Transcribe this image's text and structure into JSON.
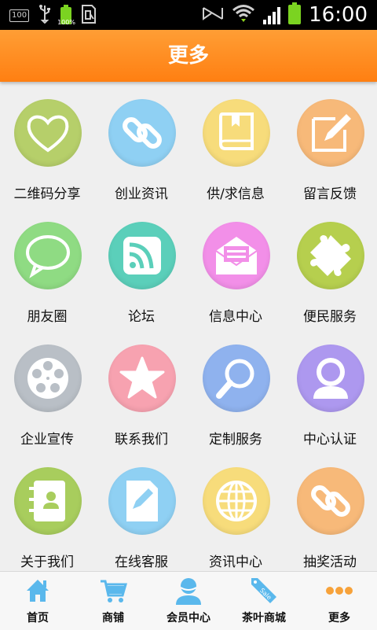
{
  "status_bar": {
    "box_text": "100",
    "battery_small": "100%",
    "time": "16:00"
  },
  "header": {
    "title": "更多"
  },
  "grid": {
    "items": [
      {
        "label": "二维码分享",
        "icon": "heart-icon",
        "color": "#b6cf6a"
      },
      {
        "label": "创业资讯",
        "icon": "link-icon",
        "color": "#8fd0f3"
      },
      {
        "label": "供/求信息",
        "icon": "book-icon",
        "color": "#f7dc7b"
      },
      {
        "label": "留言反馈",
        "icon": "edit-icon",
        "color": "#f7b979"
      },
      {
        "label": "朋友圈",
        "icon": "chat-bubble-icon",
        "color": "#8fdb83"
      },
      {
        "label": "论坛",
        "icon": "rss-icon",
        "color": "#5bcfba"
      },
      {
        "label": "信息中心",
        "icon": "envelope-icon",
        "color": "#f28fe8"
      },
      {
        "label": "便民服务",
        "icon": "puzzle-icon",
        "color": "#b6cf4e"
      },
      {
        "label": "企业宣传",
        "icon": "film-reel-icon",
        "color": "#b9bfc6"
      },
      {
        "label": "联系我们",
        "icon": "star-icon",
        "color": "#f7a2b0"
      },
      {
        "label": "定制服务",
        "icon": "magnifier-icon",
        "color": "#8fb2ee"
      },
      {
        "label": "中心认证",
        "icon": "user-icon",
        "color": "#ad98ef"
      },
      {
        "label": "关于我们",
        "icon": "contact-book-icon",
        "color": "#a8cd5d"
      },
      {
        "label": "在线客服",
        "icon": "document-pen-icon",
        "color": "#8fd0f3"
      },
      {
        "label": "资讯中心",
        "icon": "globe-icon",
        "color": "#f7dc7b"
      },
      {
        "label": "抽奖活动",
        "icon": "link-icon",
        "color": "#f7b979"
      }
    ]
  },
  "bottom_nav": {
    "items": [
      {
        "label": "首页",
        "icon": "home-icon"
      },
      {
        "label": "商铺",
        "icon": "cart-icon"
      },
      {
        "label": "会员中心",
        "icon": "member-icon"
      },
      {
        "label": "茶叶商城",
        "icon": "sale-tag-icon",
        "tag_text": "Sale"
      },
      {
        "label": "更多",
        "icon": "more-dots-icon"
      }
    ],
    "icon_color": "#5ab8ec",
    "active_color": "#f7a23a"
  }
}
